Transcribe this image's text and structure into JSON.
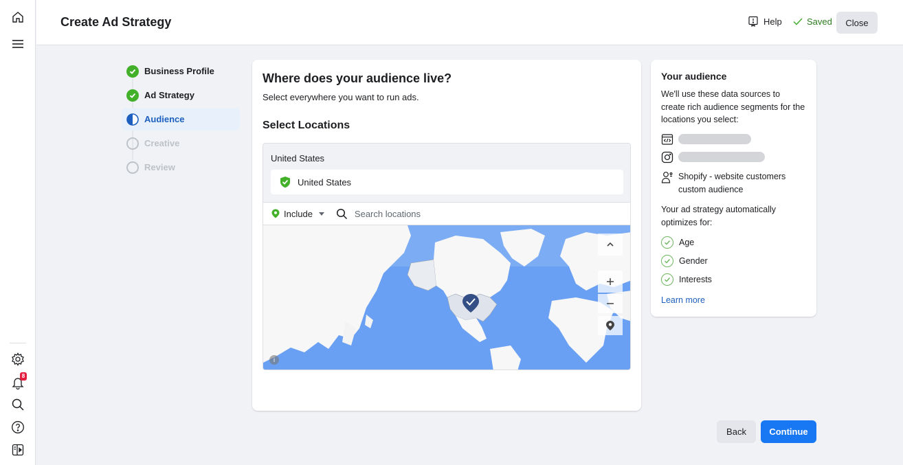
{
  "rail": {
    "notification_count": "8"
  },
  "header": {
    "title": "Create Ad Strategy",
    "help_label": "Help",
    "saved_label": "Saved",
    "close_label": "Close"
  },
  "steps": [
    {
      "label": "Business Profile",
      "state": "complete"
    },
    {
      "label": "Ad Strategy",
      "state": "complete"
    },
    {
      "label": "Audience",
      "state": "in-progress"
    },
    {
      "label": "Creative",
      "state": "not-started"
    },
    {
      "label": "Review",
      "state": "not-started"
    }
  ],
  "main": {
    "heading": "Where does your audience live?",
    "subheading": "Select everywhere you want to run ads.",
    "section_title": "Select Locations",
    "selected_group_label": "United States",
    "selected_locations": [
      "United States"
    ],
    "include_label": "Include",
    "search_placeholder": "Search locations"
  },
  "aside": {
    "title": "Your audience",
    "description": "We'll use these data sources to create rich audience segments for the locations you select:",
    "sources": [
      {
        "icon": "website-code-icon"
      },
      {
        "icon": "instagram-icon"
      },
      {
        "icon": "people-icon",
        "label": "Shopify - website customers custom audience"
      }
    ],
    "optimizes_text": "Your ad strategy automatically optimizes for:",
    "optimizations": [
      "Age",
      "Gender",
      "Interests"
    ],
    "learn_more": "Learn more"
  },
  "footer": {
    "back_label": "Back",
    "continue_label": "Continue"
  },
  "colors": {
    "primary": "#1877f2",
    "success": "#43b02a",
    "saved_text": "#2d7d1e",
    "active_step_bg": "#e7f0fb",
    "map_ocean": "#6aa0f3"
  }
}
